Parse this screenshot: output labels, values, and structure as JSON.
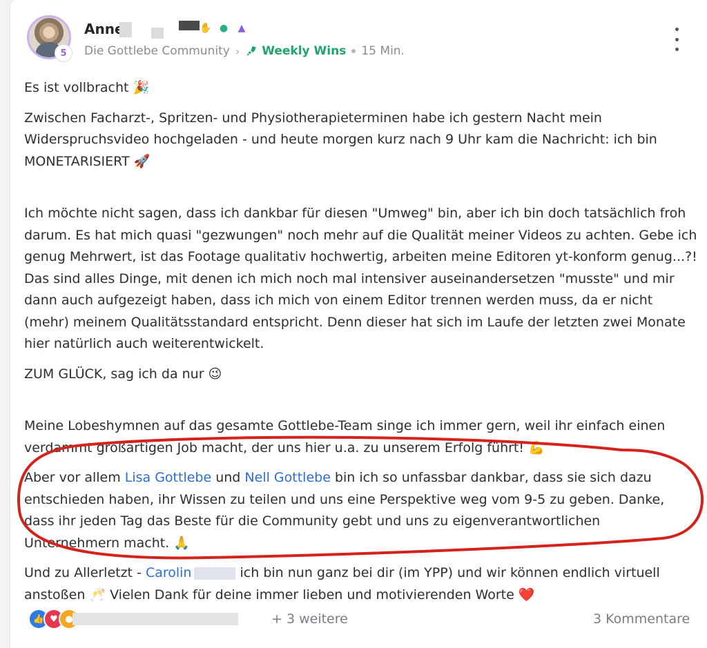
{
  "post": {
    "author": {
      "name_visible": "Anne",
      "level": "5",
      "badges": [
        "handshake-icon",
        "chat-bubble-icon",
        "graduation-cap-icon"
      ]
    },
    "meta": {
      "community": "Die Gottlebe Community",
      "space": "Weekly Wins",
      "time": "15 Min."
    },
    "body": {
      "p1": "Es ist vollbracht 🎉",
      "p2": "Zwischen Facharzt-, Spritzen- und Physiotherapieterminen habe ich gestern Nacht mein Widerspruchsvideo hochgeladen - und heute morgen kurz nach 9 Uhr kam die Nachricht: ich bin MONETARISIERT 🚀",
      "p3": "Ich möchte nicht sagen, dass ich dankbar für diesen \"Umweg\" bin, aber ich bin doch tatsächlich froh darum. Es hat mich quasi \"gezwungen\" noch mehr auf die Qualität meiner Videos zu achten. Gebe ich genug Mehrwert, ist das Footage qualitativ hochwertig, arbeiten meine Editoren yt-konform genug...?! Das sind alles Dinge, mit denen ich mich noch mal intensiver auseinandersetzen \"musste\" und mir dann auch aufgezeigt haben, dass ich mich von einem Editor trennen werden muss, da er nicht (mehr) meinem Qualitätsstandard entspricht. Denn dieser hat sich im Laufe der letzten zwei Monate hier natürlich auch weiterentwickelt.",
      "p4": "ZUM GLÜCK, sag ich da nur 😉",
      "p5": "Meine Lobeshymnen auf das gesamte Gottlebe-Team singe ich immer gern, weil ihr einfach einen verdammt großartigen Job macht, der uns hier u.a. zu unserem Erfolg führt! 💪",
      "p6_start": "Aber vor allem ",
      "mention1": "Lisa Gottlebe",
      "p6_and": " und ",
      "mention2": "Nell Gottlebe",
      "p6_end": " bin ich so unfassbar dankbar, dass sie sich dazu entschieden haben, ihr Wissen zu teilen und uns eine Perspektive weg vom 9-5 zu geben. Danke, dass ihr jeden Tag das Beste für die Community gebt und uns zu eigenverantwortlichen Unternehmern macht. 🙏",
      "p7_start": "Und zu Allerletzt - ",
      "mention3": "Carolin",
      "p7_end": " ich bin nun ganz bei dir (im YPP) und wir können endlich virtuell anstoßen 🥂 Vielen Dank für deine immer lieben und motivierenden Worte ❤️"
    },
    "footer": {
      "reactions": [
        "like-icon",
        "love-icon",
        "care-icon"
      ],
      "more_reactors": "+ 3 weitere",
      "comments": "3 Kommentare"
    }
  },
  "colors": {
    "accent_green": "#1ea56c",
    "mention_blue": "#2a6fd6",
    "annotation_red": "#d4231c",
    "level_purple": "#9a62e0"
  }
}
